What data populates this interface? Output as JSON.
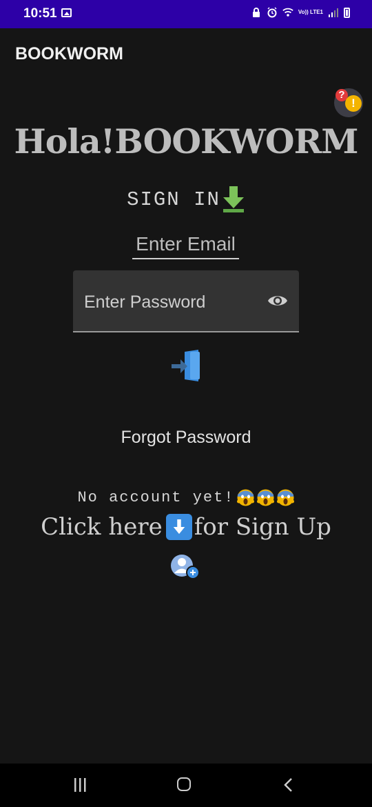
{
  "status_bar": {
    "time": "10:51",
    "network_label": "Vo)) LTE1",
    "background_color": "#2d00a7"
  },
  "app_bar": {
    "title": "BOOKWORM"
  },
  "hero": {
    "title": "Hola!BOOKWORM"
  },
  "signin": {
    "label": "SIGN IN",
    "arrow_icon": "green-down-arrow-icon"
  },
  "email": {
    "placeholder": "Enter Email",
    "value": ""
  },
  "password": {
    "placeholder": "Enter Password",
    "value": "",
    "toggle_icon": "eye-icon"
  },
  "login": {
    "icon": "enter-door-icon"
  },
  "forgot": {
    "label": "Forgot Password"
  },
  "no_account": {
    "text": "No account yet!",
    "emoji_icon": "screaming-face-icon"
  },
  "signup": {
    "prefix": "Click here",
    "suffix": "for Sign Up",
    "icon": "add-user-icon"
  },
  "colors": {
    "background": "#151515",
    "text": "#d0d0d0",
    "field": "#333333",
    "accent_blue": "#3a8de0"
  }
}
